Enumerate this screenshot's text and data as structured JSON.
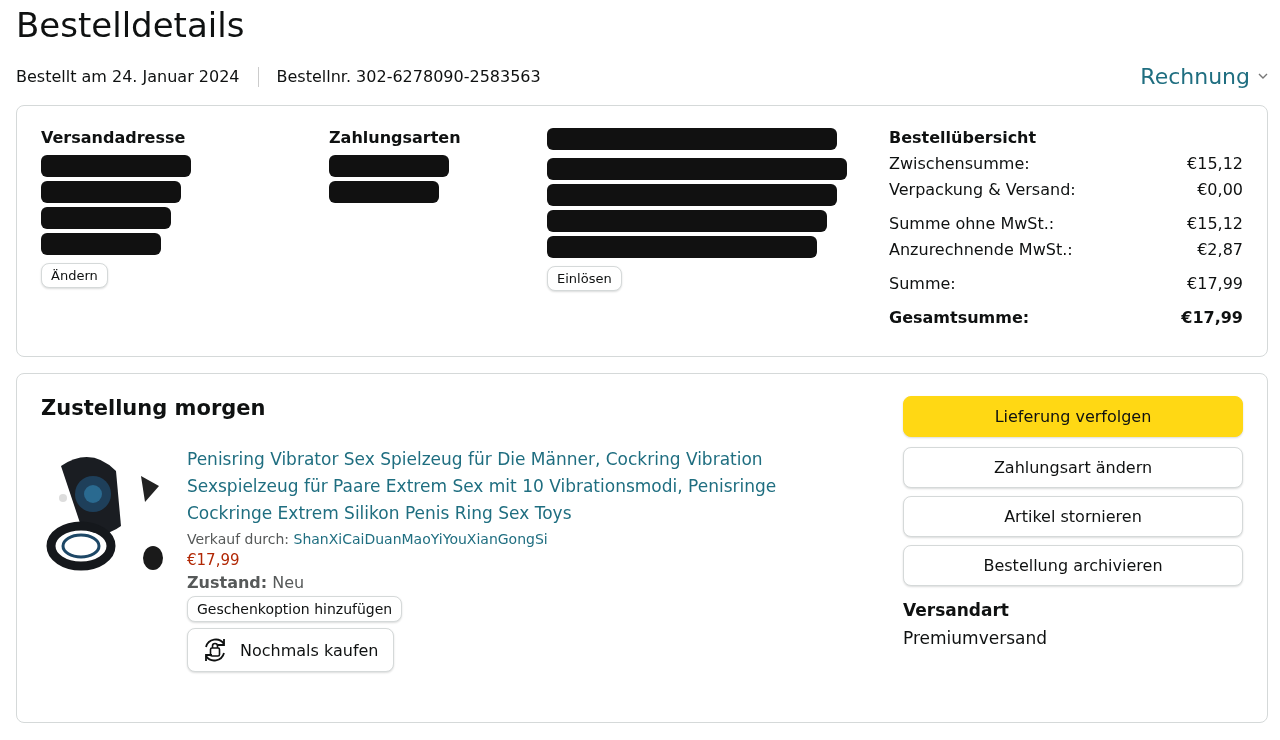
{
  "title": "Bestelldetails",
  "meta": {
    "ordered": "Bestellt am 24. Januar 2024",
    "order_number": "Bestellnr. 302-6278090-2583563",
    "invoice": "Rechnung"
  },
  "info": {
    "columns": [
      {
        "heading": "Versandadresse",
        "button": "Ändern"
      },
      {
        "heading": "Zahlungsarten"
      },
      {
        "button": "Einlösen"
      }
    ],
    "summary": {
      "heading": "Bestellübersicht",
      "groups": [
        [
          {
            "label": "Zwischensumme:",
            "value": "€15,12",
            "kind": "line"
          },
          {
            "label": "Verpackung & Versand:",
            "value": "€0,00",
            "kind": "line"
          }
        ],
        [
          {
            "label": "Summe ohne MwSt.:",
            "value": "€15,12",
            "kind": "line"
          },
          {
            "label": "Anzurechnende MwSt.:",
            "value": "€2,87",
            "kind": "line"
          }
        ],
        [
          {
            "label": "Summe:",
            "value": "€17,99",
            "kind": "line"
          }
        ],
        [
          {
            "label": "Gesamtsumme:",
            "value": "€17,99",
            "kind": "total"
          }
        ]
      ]
    }
  },
  "delivery": {
    "heading": "Zustellung morgen",
    "item": {
      "title": "Penisring Vibrator Sex Spielzeug für Die Männer, Cockring Vibration Sexspielzeug für Paare Extrem Sex mit 10 Vibrationsmodi, Penisringe Cockringe Extrem Silikon Penis Ring Sex Toys",
      "seller_label": "Verkauf durch:",
      "seller": "ShanXiCaiDuanMaoYiYouXianGongSi",
      "price": "€17,99",
      "condition_label": "Zustand:",
      "condition": "Neu",
      "gift_button": "Geschenkoption hinzufügen",
      "buy_again": "Nochmals kaufen"
    },
    "actions": [
      {
        "label": "Lieferung verfolgen",
        "kind": "primary"
      },
      {
        "label": "Zahlungsart ändern",
        "kind": "secondary"
      },
      {
        "label": "Artikel stornieren",
        "kind": "secondary"
      },
      {
        "label": "Bestellung archivieren",
        "kind": "secondary"
      }
    ],
    "shipping_heading": "Versandart",
    "shipping": "Premiumversand"
  }
}
